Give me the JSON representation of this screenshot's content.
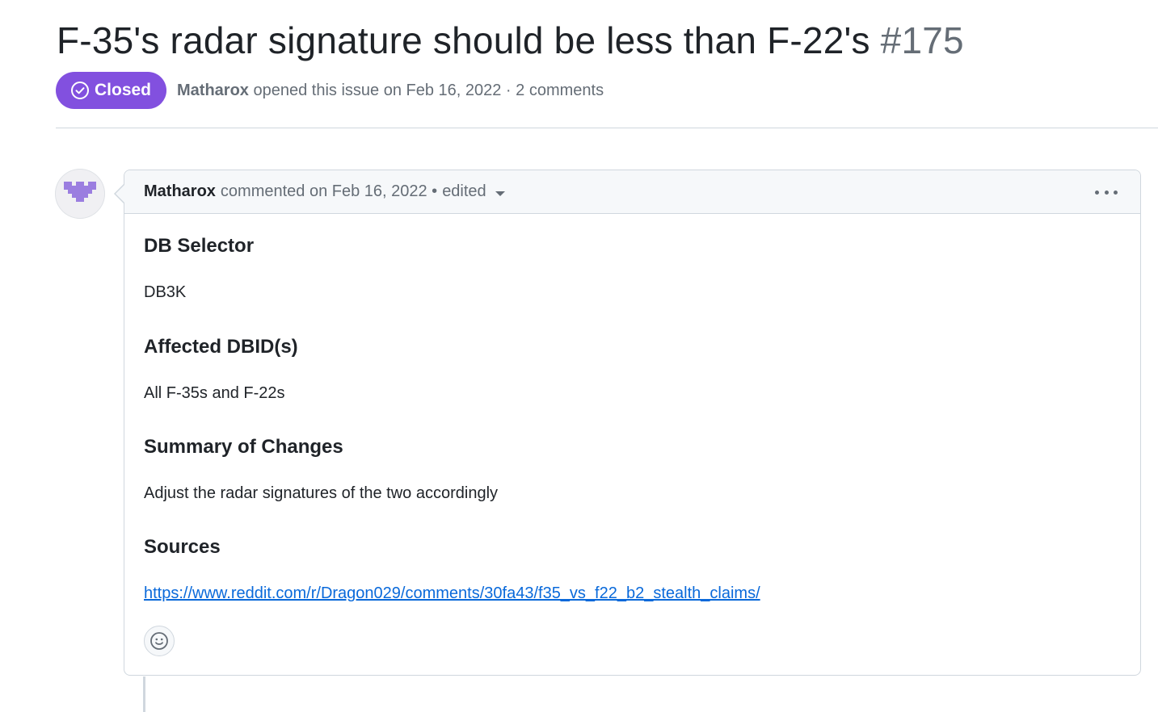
{
  "issue": {
    "title": "F-35's radar signature should be less than F-22's",
    "number": "#175",
    "state": "Closed",
    "author": "Matharox",
    "opened_text": "opened this issue on Feb 16, 2022 · 2 comments"
  },
  "comment": {
    "author": "Matharox",
    "meta": "commented on Feb 16, 2022 •",
    "edited": "edited",
    "sections": [
      {
        "heading": "DB Selector",
        "text": "DB3K"
      },
      {
        "heading": "Affected DBID(s)",
        "text": "All F-35s and F-22s"
      },
      {
        "heading": "Summary of Changes",
        "text": "Adjust the radar signatures of the two accordingly"
      },
      {
        "heading": "Sources",
        "link": "https://www.reddit.com/r/Dragon029/comments/30fa43/f35_vs_f22_b2_stealth_claims/"
      }
    ]
  },
  "colors": {
    "closed_badge": "#8250df",
    "link": "#0969da",
    "avatar_pixels": "#9b7ee0"
  },
  "icons": {
    "state": "check-circle-icon",
    "options": "kebab-horizontal-icon",
    "reaction": "smiley-icon",
    "edited_menu": "triangle-down-icon"
  }
}
